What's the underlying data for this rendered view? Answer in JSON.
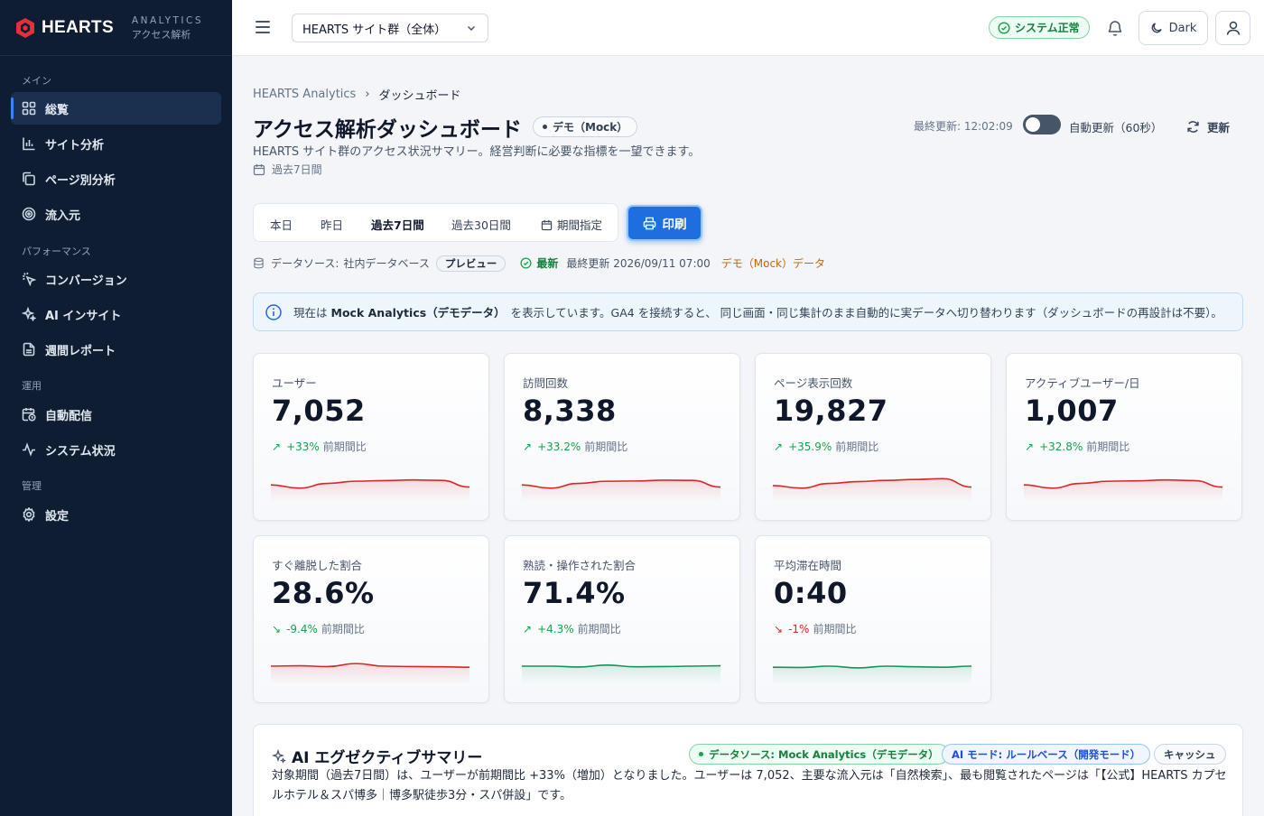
{
  "brand": {
    "name": "HEARTS",
    "sub1": "ANALYTICS",
    "sub2": "アクセス解析"
  },
  "sidebar": {
    "sections": [
      {
        "label": "メイン"
      },
      {
        "label": "パフォーマンス"
      },
      {
        "label": "運用"
      },
      {
        "label": "管理"
      }
    ],
    "items": [
      {
        "label": "総覧",
        "icon": "grid-icon",
        "active": true
      },
      {
        "label": "サイト分析",
        "icon": "bar-chart-icon"
      },
      {
        "label": "ページ別分析",
        "icon": "copy-icon"
      },
      {
        "label": "流入元",
        "icon": "target-icon"
      },
      {
        "label": "コンバージョン",
        "icon": "pointer-click-icon"
      },
      {
        "label": "AI インサイト",
        "icon": "sparkles-icon"
      },
      {
        "label": "週間レポート",
        "icon": "document-icon"
      },
      {
        "label": "自動配信",
        "icon": "calendar-clock-icon"
      },
      {
        "label": "システム状況",
        "icon": "activity-icon"
      },
      {
        "label": "設定",
        "icon": "gear-icon"
      }
    ]
  },
  "topbar": {
    "site_select": "HEARTS サイト群（全体）",
    "status": "システム正常",
    "dark_label": "Dark"
  },
  "header": {
    "breadcrumb": [
      "HEARTS Analytics",
      "ダッシュボード"
    ],
    "title": "アクセス解析ダッシュボード",
    "demo_badge": "デモ（Mock）",
    "subtitle": "HEARTS サイト群のアクセス状況サマリー。経営判断に必要な指標を一望できます。",
    "period": "過去7日間",
    "last_updated": "最終更新: 12:02:09",
    "auto_refresh": "自動更新（60秒）",
    "auto_refresh_on": false,
    "refresh_label": "更新"
  },
  "range_tabs": [
    "本日",
    "昨日",
    "過去7日間",
    "過去30日間",
    "期間指定"
  ],
  "range_active": 2,
  "print_label": "印刷",
  "datasource": {
    "label": "データソース:",
    "value": "社内データベース",
    "badge": "プレビュー",
    "latest": "最新",
    "updated": "最終更新 2026/09/11 07:00",
    "mock": "デモ（Mock）データ"
  },
  "info": {
    "pre": "現在は",
    "bold": "Mock Analytics（デモデータ）",
    "post": "を表示しています。GA4 を接続すると、 同じ画面・同じ集計のまま自動的に実データへ切り替わります（ダッシュボードの再設計は不要）。"
  },
  "kpis": [
    {
      "label": "ユーザー",
      "value": "7,052",
      "arrow": "↗",
      "delta": "+33%",
      "cmp": "前期間比",
      "trend": "up",
      "color": "#dc2626",
      "series": [
        0.45,
        0.3,
        0.52,
        0.62,
        0.65,
        0.68,
        0.66,
        0.35
      ]
    },
    {
      "label": "訪問回数",
      "value": "8,338",
      "arrow": "↗",
      "delta": "+33.2%",
      "cmp": "前期間比",
      "trend": "up",
      "color": "#dc2626",
      "series": [
        0.45,
        0.3,
        0.52,
        0.62,
        0.63,
        0.67,
        0.66,
        0.35
      ]
    },
    {
      "label": "ページ表示回数",
      "value": "19,827",
      "arrow": "↗",
      "delta": "+35.9%",
      "cmp": "前期間比",
      "trend": "up",
      "color": "#dc2626",
      "series": [
        0.42,
        0.3,
        0.52,
        0.6,
        0.66,
        0.7,
        0.74,
        0.35
      ]
    },
    {
      "label": "アクティブユーザー/日",
      "value": "1,007",
      "arrow": "↗",
      "delta": "+32.8%",
      "cmp": "前期間比",
      "trend": "up",
      "color": "#dc2626",
      "series": [
        0.45,
        0.3,
        0.52,
        0.62,
        0.64,
        0.68,
        0.65,
        0.35
      ]
    },
    {
      "label": "すぐ離脱した割合",
      "value": "28.6%",
      "arrow": "↘",
      "delta": "-9.4%",
      "cmp": "前期間比",
      "trend": "down-good",
      "color": "#dc2626",
      "series": [
        0.5,
        0.52,
        0.48,
        0.62,
        0.5,
        0.48,
        0.47,
        0.45
      ]
    },
    {
      "label": "熟読・操作された割合",
      "value": "71.4%",
      "arrow": "↗",
      "delta": "+4.3%",
      "cmp": "前期間比",
      "trend": "up",
      "color": "#15935a",
      "series": [
        0.5,
        0.5,
        0.46,
        0.55,
        0.47,
        0.48,
        0.5,
        0.52
      ]
    },
    {
      "label": "平均滞在時間",
      "value": "0:40",
      "arrow": "↘",
      "delta": "-1%",
      "cmp": "前期間比",
      "trend": "down-bad",
      "color": "#15935a",
      "series": [
        0.45,
        0.44,
        0.5,
        0.42,
        0.5,
        0.47,
        0.45,
        0.5
      ]
    }
  ],
  "ai": {
    "title": "AI エグゼクティブサマリー",
    "badge_source": "データソース: Mock Analytics（デモデータ）",
    "badge_mode": "AI モード: ルールベース（開発モード）",
    "badge_cache": "キャッシュ",
    "text": "対象期間（過去7日間）は、ユーザーが前期間比 +33%（増加）となりました。ユーザーは 7,052、主要な流入元は「自然検索」、最も閲覧されたページは「【公式】HEARTS カプセルホテル＆スパ博多｜博多駅徒歩3分・スパ併設」です。"
  }
}
